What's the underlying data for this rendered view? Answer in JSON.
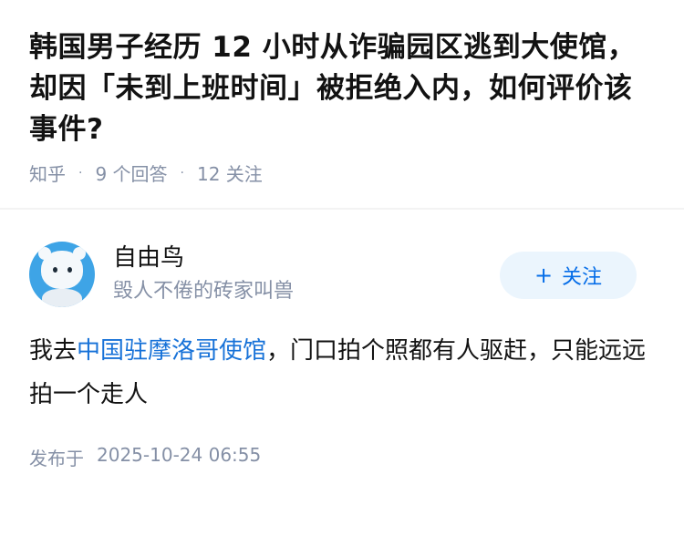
{
  "question": {
    "title": "韩国男子经历 12 小时从诈骗园区逃到大使馆，却因「未到上班时间」被拒绝入内，如何评价该事件?",
    "source": "知乎",
    "answers": "9 个回答",
    "followers": "12 关注"
  },
  "answer": {
    "author": {
      "name": "自由鸟",
      "bio": "毁人不倦的砖家叫兽",
      "avatar_icon": "dog-avatar-icon"
    },
    "follow_button": {
      "icon": "+",
      "label": "关注"
    },
    "content": {
      "before": "我去",
      "link": "中国驻摩洛哥使馆",
      "after": "，门口拍个照都有人驱赶，只能远远拍一个走人"
    },
    "publish_label": "发布于",
    "publish_time": "2025-10-24 06:55"
  },
  "colors": {
    "accent": "#056de8",
    "link": "#1772d8",
    "meta": "#8590a6",
    "follow_bg": "#ebf5fd"
  }
}
